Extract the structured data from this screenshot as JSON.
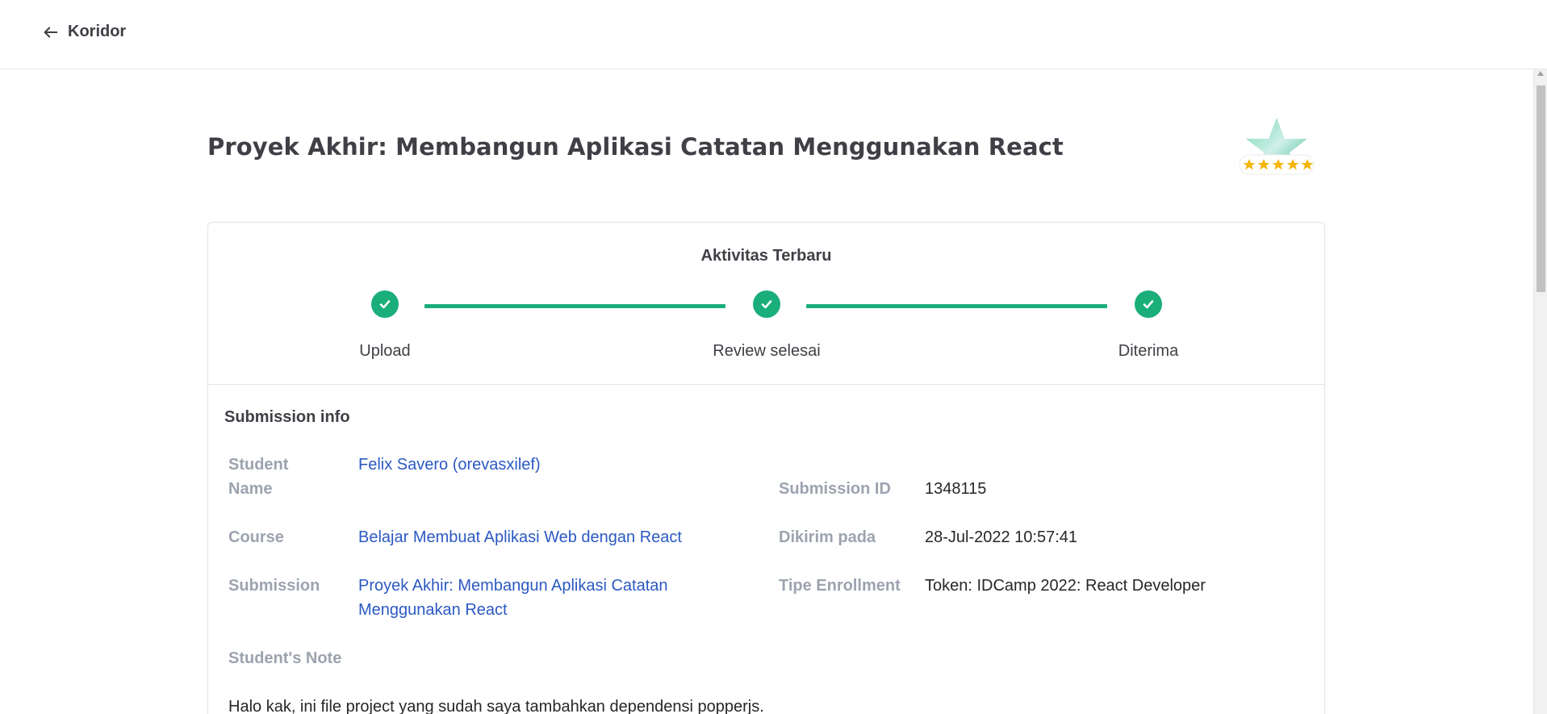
{
  "header": {
    "back_label": "Koridor"
  },
  "page": {
    "title": "Proyek Akhir: Membangun Aplikasi Catatan Menggunakan React"
  },
  "activity": {
    "title": "Aktivitas Terbaru",
    "steps": [
      {
        "label": "Upload",
        "done": true
      },
      {
        "label": "Review selesai",
        "done": true
      },
      {
        "label": "Diterima",
        "done": true
      }
    ]
  },
  "submission": {
    "section_title": "Submission info",
    "student_name_label_line1": "Student",
    "student_name_label_line2": "Name",
    "student_name": "Felix Savero (orevasxilef)",
    "course_label": "Course",
    "course": "Belajar Membuat Aplikasi Web dengan React",
    "submission_label": "Submission",
    "submission_line1": "Proyek Akhir: Membangun Aplikasi Catatan",
    "submission_line2": "Menggunakan React",
    "submission_id_label": "Submission ID",
    "submission_id": "1348115",
    "sent_label": "Dikirim pada",
    "sent_at": "28-Jul-2022 10:57:41",
    "enrollment_label": "Tipe Enrollment",
    "enrollment": "Token: IDCamp 2022: React Developer",
    "note_label": "Student's Note",
    "note": "Halo kak, ini file project yang sudah saya tambahkan dependensi popperjs."
  },
  "colors": {
    "accent": "#1aae7a",
    "link": "#2b59c3",
    "label": "#9ca3af",
    "star": "#f5b50a"
  },
  "icons": {
    "back": "arrow-left-icon",
    "check": "check-icon",
    "badge": "star-rating-badge-icon"
  }
}
